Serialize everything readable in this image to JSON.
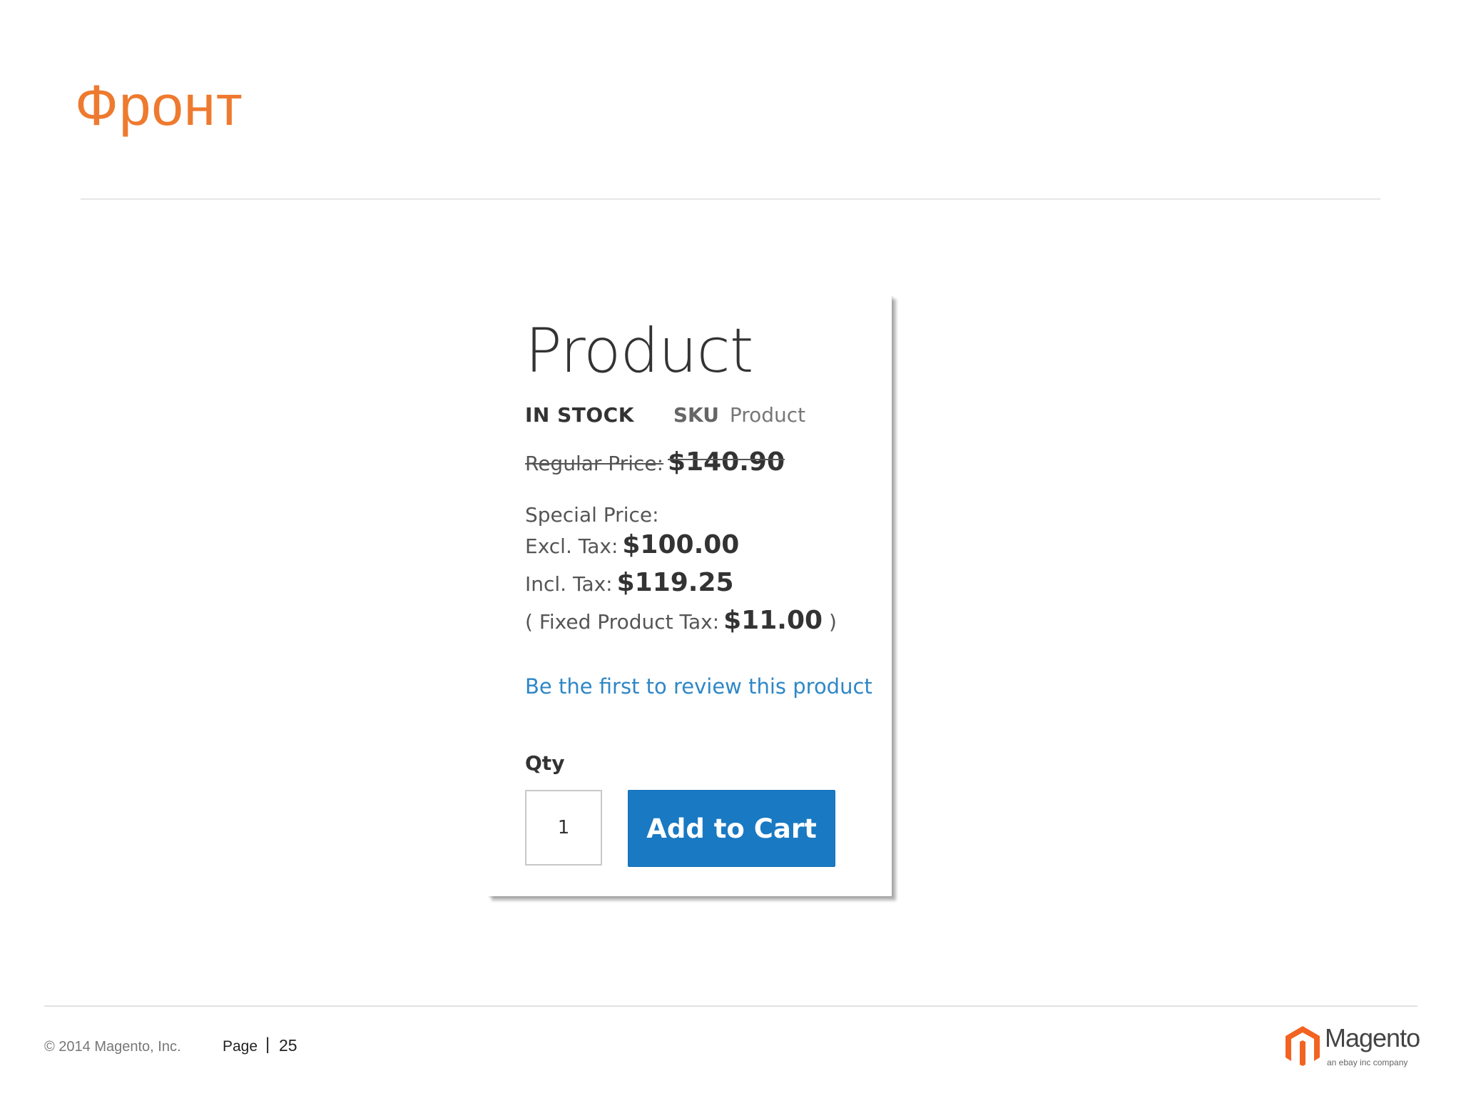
{
  "slide": {
    "title": "Фронт"
  },
  "product": {
    "name": "Product",
    "stock": "IN STOCK",
    "sku_label": "SKU",
    "sku_value": "Product",
    "regular_price_label": "Regular Price:",
    "regular_price": "$140.90",
    "special_price_label": "Special Price:",
    "excl_tax_label": "Excl. Tax:",
    "excl_tax_price": "$100.00",
    "incl_tax_label": "Incl. Tax:",
    "incl_tax_price": "$119.25",
    "fixed_tax_open": "( Fixed Product Tax:",
    "fixed_tax_price": "$11.00",
    "fixed_tax_close": ")",
    "review_link": "Be the first to review this product",
    "qty_label": "Qty",
    "qty_value": "1",
    "add_to_cart": "Add to Cart"
  },
  "footer": {
    "copyright": "© 2014 Magento, Inc.",
    "page_label": "Page",
    "separator": "|",
    "page_number": "25",
    "logo_word": "Magento",
    "logo_sub": "an ebay inc company"
  },
  "colors": {
    "title": "#ee7a2f",
    "button": "#1979c3",
    "link": "#2e87c7",
    "logo": "#f26322"
  }
}
